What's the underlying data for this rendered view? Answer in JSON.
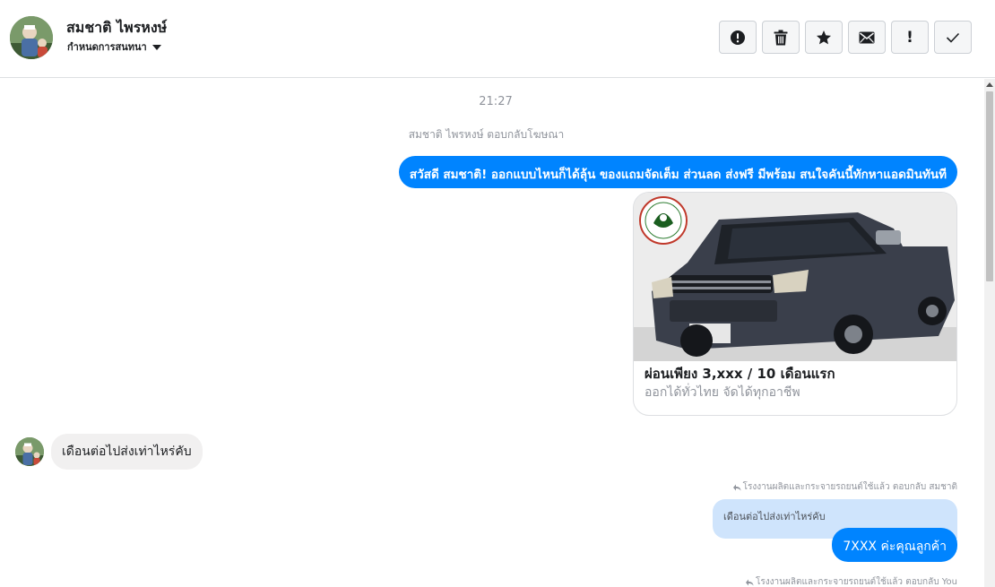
{
  "header": {
    "contact_name": "สมชาติ ไพรหงษ์",
    "conversation_settings_label": "กำหนดการสนทนา",
    "toolbar_icons": [
      "alert-circle-icon",
      "trash-icon",
      "star-icon",
      "envelope-icon",
      "exclamation-icon",
      "check-icon"
    ],
    "exclamation_glyph": "!"
  },
  "chat": {
    "timestamp": "21:27",
    "ad_reply_note": "สมชาติ ไพรหงษ์ ตอบกลับโฆษณา",
    "greeting_message": "สวัสดี สมชาติ! ออกแบบไหนก็ได้ลุ้น ของแถมจัดเต็ม ส่วนลด ส่งฟรี มีพร้อม สนใจคันนี้ทักหาแอดมินทันที",
    "ad_card": {
      "title": "ผ่อนเพียง 3,xxx / 10 เดือนแรก",
      "subtitle": "ออกได้ทั่วไทย จัดได้ทุกอาชีพ"
    },
    "incoming_message": "เดือนต่อไปส่งเท่าไหร่คับ",
    "reply_meta_1": "โรงงานผลิตและกระจายรถยนต์ใช้แล้ว ตอบกลับ สมชาติ",
    "quoted_message": "เดือนต่อไปส่งเท่าไหร่คับ",
    "reply_message": "7XXX  ค่ะคุณลูกค้า",
    "reply_meta_2": "โรงงานผลิตและกระจายรถยนต์ใช้แล้ว ตอบกลับ You"
  },
  "colors": {
    "accent": "#0084ff",
    "incoming_bubble": "#f1f0f0",
    "quote_bubble": "#cfe4fc",
    "muted_text": "#90949c"
  }
}
